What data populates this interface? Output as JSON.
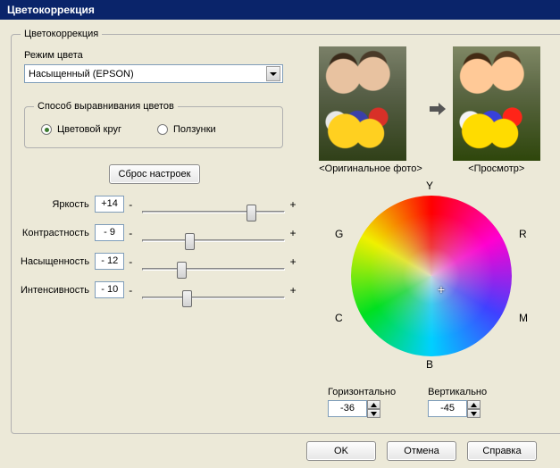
{
  "title": "Цветокоррекция",
  "group_title": "Цветокоррекция",
  "color_mode": {
    "label": "Режим цвета",
    "value": "Насыщенный (EPSON)"
  },
  "align_group": {
    "title": "Способ выравнивания цветов",
    "option_wheel": "Цветовой круг",
    "option_sliders": "Ползунки",
    "selected": "wheel"
  },
  "reset_label": "Сброс настроек",
  "sliders": {
    "brightness": {
      "label": "Яркость",
      "value": "+14",
      "pos": 0.78
    },
    "contrast": {
      "label": "Контрастность",
      "value": "- 9",
      "pos": 0.32
    },
    "saturation": {
      "label": "Насыщенность",
      "value": "- 12",
      "pos": 0.26
    },
    "intensity": {
      "label": "Интенсивность",
      "value": "- 10",
      "pos": 0.3
    }
  },
  "minus": "-",
  "plus": "+",
  "preview": {
    "original_label": "<Оригинальное фото>",
    "preview_label": "<Просмотр>"
  },
  "wheel_letters": {
    "Y": "Y",
    "G": "G",
    "R": "R",
    "C": "C",
    "M": "M",
    "B": "B"
  },
  "hv": {
    "h_label": "Горизонтально",
    "h_value": "-36",
    "v_label": "Вертикально",
    "v_value": "-45"
  },
  "buttons": {
    "ok": "OK",
    "cancel": "Отмена",
    "help": "Справка"
  }
}
